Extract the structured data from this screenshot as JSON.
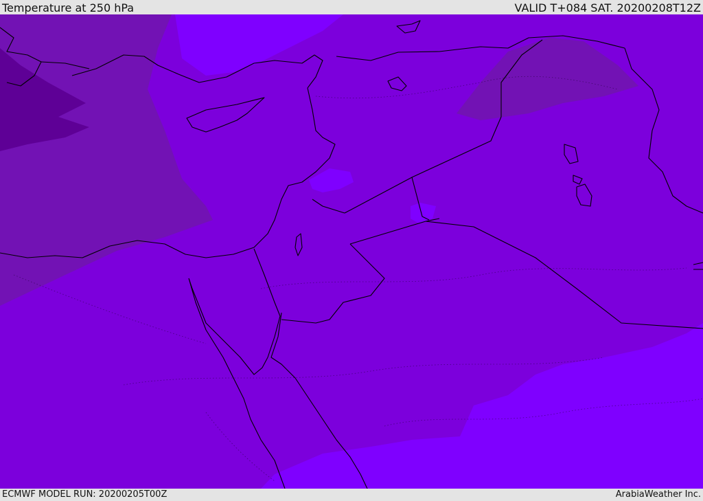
{
  "header": {
    "title": "Temperature at 250 hPa",
    "valid_time": "VALID T+084 SAT. 20200208T12Z"
  },
  "footer": {
    "model_run": "ECMWF MODEL RUN: 20200205T00Z",
    "credit": "ArabiaWeather Inc."
  },
  "map": {
    "variable": "Temperature",
    "level": "250 hPa",
    "colors": {
      "coldest": "#5e0096",
      "cold": "#7212b4",
      "mid": "#7c00dc",
      "warm": "#7f00ff",
      "coast": "#000000"
    }
  }
}
